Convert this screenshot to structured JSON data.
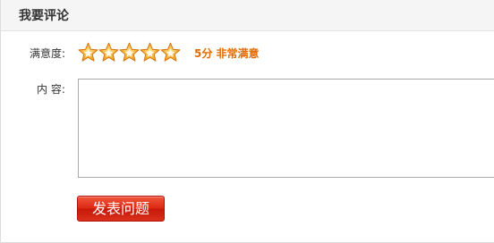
{
  "panel": {
    "title": "我要评论"
  },
  "rating": {
    "label": "满意度:",
    "value": 5,
    "max": 5,
    "text": "5分 非常满意",
    "star_icon": "star-icon",
    "star_color": "#f39c12",
    "text_color": "#e36a00"
  },
  "content": {
    "label": "内 容:",
    "value": "",
    "placeholder": ""
  },
  "submit": {
    "label": "发表问题",
    "color": "#d9301b"
  }
}
